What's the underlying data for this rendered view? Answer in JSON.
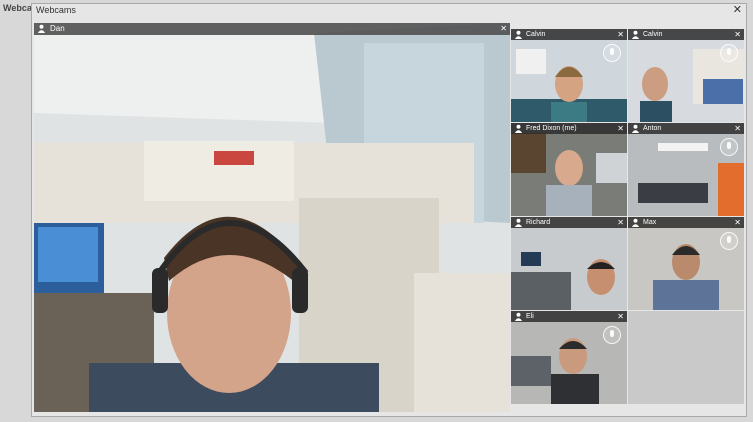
{
  "app": {
    "title": "Webcams"
  },
  "window": {
    "title": "Webcams",
    "close_label": "✕"
  },
  "main_feed": {
    "name": "Dan",
    "close_label": "✕"
  },
  "thumbnails": [
    {
      "name": "Calvin",
      "close_label": "✕"
    },
    {
      "name": "Calvin",
      "close_label": "✕"
    },
    {
      "name": "Fred Dixon (me)",
      "close_label": "✕"
    },
    {
      "name": "Anton",
      "close_label": "✕"
    },
    {
      "name": "Richard",
      "close_label": "✕"
    },
    {
      "name": "Max",
      "close_label": "✕"
    },
    {
      "name": "Eli",
      "close_label": "✕"
    }
  ],
  "colors": {
    "title_bar": "#2d2d2d",
    "window_bg": "#e6e6e6",
    "page_bg": "#d8d8d8"
  },
  "icons": {
    "user": "user-icon",
    "mic": "mic-icon",
    "close": "close-icon"
  }
}
